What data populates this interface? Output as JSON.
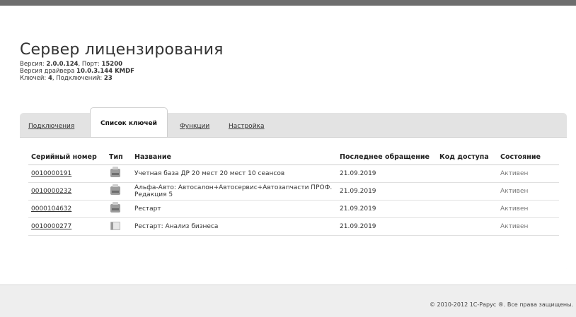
{
  "header": {
    "title": "Сервер лицензирования",
    "version_label": "Версия: ",
    "version_value": "2.0.0.124",
    "port_label": ", Порт: ",
    "port_value": "15200",
    "driver_label": "Версия драйвера ",
    "driver_value": "10.0.3.144 KMDF",
    "keys_label": "Ключей: ",
    "keys_value": "4",
    "connections_label": ", Подключений: ",
    "connections_value": "23"
  },
  "tabs": [
    {
      "label": "Подключения",
      "active": false
    },
    {
      "label": "Список ключей",
      "active": true
    },
    {
      "label": "Функции",
      "active": false
    },
    {
      "label": "Настройка",
      "active": false
    }
  ],
  "table": {
    "columns": [
      "Серийный номер",
      "Тип",
      "Название",
      "Последнее обращение",
      "Код доступа",
      "Состояние"
    ],
    "rows": [
      {
        "serial": "0010000191",
        "type_icon": "usb-key-icon",
        "name": "Учетная база ДР 20 мест 20 мест 10 сеансов",
        "last_access": "21.09.2019",
        "access_code": "",
        "status": "Активен"
      },
      {
        "serial": "0010000232",
        "type_icon": "usb-key-icon",
        "name": "Альфа-Авто: Автосалон+Автосервис+Автозапчасти ПРОФ. Редакция 5",
        "last_access": "21.09.2019",
        "access_code": "",
        "status": "Активен"
      },
      {
        "serial": "0000104632",
        "type_icon": "usb-key-icon",
        "name": "Рестарт",
        "last_access": "21.09.2019",
        "access_code": "",
        "status": "Активен"
      },
      {
        "serial": "0010000277",
        "type_icon": "software-key-icon",
        "name": "Рестарт: Анализ бизнеса",
        "last_access": "21.09.2019",
        "access_code": "",
        "status": "Активен"
      }
    ]
  },
  "footer": {
    "copyright": "© 2010-2012 1С-Рарус ®. Все права защищены."
  },
  "colors": {
    "topbar": "#6e6e6e",
    "panel": "#e3e3e3",
    "status_text": "#777777"
  }
}
